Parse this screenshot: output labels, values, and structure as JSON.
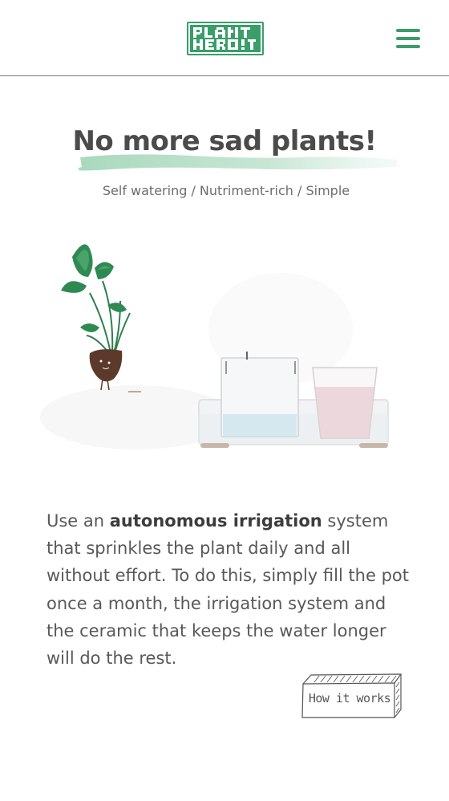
{
  "header": {
    "logo_text": "PLANT HERO",
    "menu_icon": "hamburger-menu-icon"
  },
  "hero": {
    "title": "No more sad plants!",
    "subtitle": "Self watering / Nutriment-rich / Simple"
  },
  "description": {
    "prefix": "Use an ",
    "highlight": "autonomous irrigation",
    "suffix": " system that sprinkles the plant daily and all without effort. To do this, simply fill the pot once a month, the irrigation system and the ceramic that keeps the water longer will do the rest."
  },
  "cta": {
    "label": "How it works"
  },
  "colors": {
    "brand_green": "#3a9d6a",
    "brush_green": "#a8d8bd",
    "text": "#585858"
  }
}
